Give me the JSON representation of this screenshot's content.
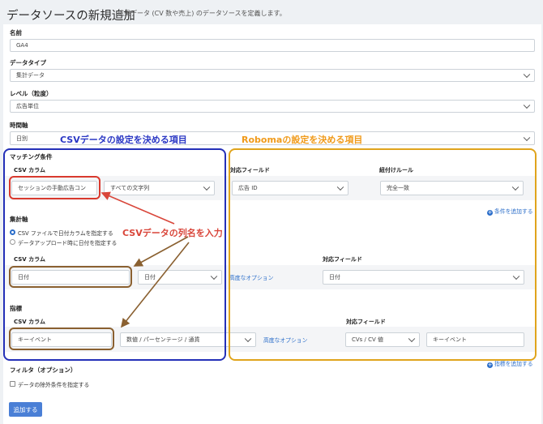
{
  "header": {
    "title": "データソースの新規追加",
    "subtitle": "成果データ (CV 数や売上) のデータソースを定義します。"
  },
  "fields": {
    "name_label": "名前",
    "name_value": "GA4",
    "type_label": "データタイプ",
    "type_value": "集計データ",
    "level_label": "レベル（粒度）",
    "level_value": "広告単位",
    "time_label": "時間軸",
    "time_value": "日別"
  },
  "matching": {
    "title": "マッチング条件",
    "csv_col_head": "CSV カラム",
    "field_head": "対応フィールド",
    "rule_head": "紐付けルール",
    "csv_col_value": "セッションの手動広告コン",
    "match_type": "すべての文字列",
    "field_value": "広告 ID",
    "rule_value": "完全一致",
    "add_condition": "条件を追加する"
  },
  "aggregation": {
    "title": "集計軸",
    "radio1": "CSV ファイルで日付カラムを指定する",
    "radio2": "データアップロード時に日付を指定する",
    "csv_col_head": "CSV カラム",
    "field_head": "対応フィールド",
    "csv_col_value": "日付",
    "format_value": "日付",
    "advanced": "高度なオプション",
    "field_value": "日付"
  },
  "metrics": {
    "title": "指標",
    "csv_col_head": "CSV カラム",
    "field_head": "対応フィールド",
    "csv_col_value": "キーイベント",
    "format_value": "数値 / パーセンテージ / 通貨",
    "advanced": "高度なオプション",
    "field_value": "CVs / CV 値",
    "field_name": "キーイベント",
    "add_metric": "指標を追加する"
  },
  "filter": {
    "title": "フィルタ（オプション）",
    "checkbox_label": "データの除外条件を指定する"
  },
  "submit_label": "追加する",
  "annotations": {
    "csv_section": "CSVデータの設定を決める項目",
    "roboma_section": "Robomaの設定を決める項目",
    "enter_column": "CSVデータの列名を入力"
  },
  "colors": {
    "annotation_blue": "#2a37c4",
    "annotation_orange": "#f09a1a",
    "annotation_red": "#d9463a",
    "link_blue": "#2a6dc9"
  }
}
